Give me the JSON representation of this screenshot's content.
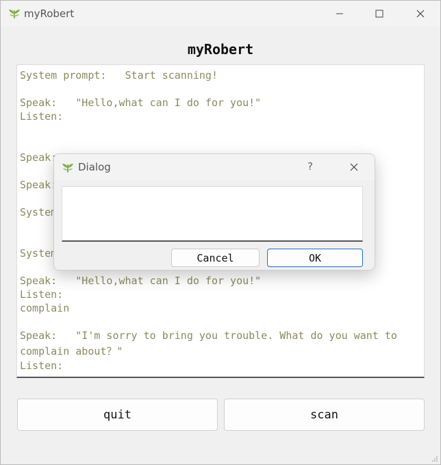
{
  "window": {
    "title": "myRobert",
    "icon": "leaf-app-icon"
  },
  "heading": "myRobert",
  "log": {
    "lines": [
      "System prompt:   Start scanning!",
      "",
      "Speak:   \"Hello,what can I do for you!\"",
      "Listen:",
      "",
      "",
      "Speak:   \"Y",
      "",
      "Speak:",
      "",
      "System",
      "",
      "",
      "System",
      "",
      "Speak:   \"Hello,what can I do for you!\"",
      "Listen:",
      "complain",
      "",
      "Speak:   \"I'm sorry to bring you trouble. What do you want to",
      "complain about？\"",
      "Listen:"
    ]
  },
  "buttons": {
    "quit": "quit",
    "scan": "scan"
  },
  "dialog": {
    "title": "Dialog",
    "help": "?",
    "input_value": "",
    "cancel": "Cancel",
    "ok": "OK"
  },
  "colors": {
    "log_text": "#8a8a60",
    "accent": "#1f6fc8"
  }
}
